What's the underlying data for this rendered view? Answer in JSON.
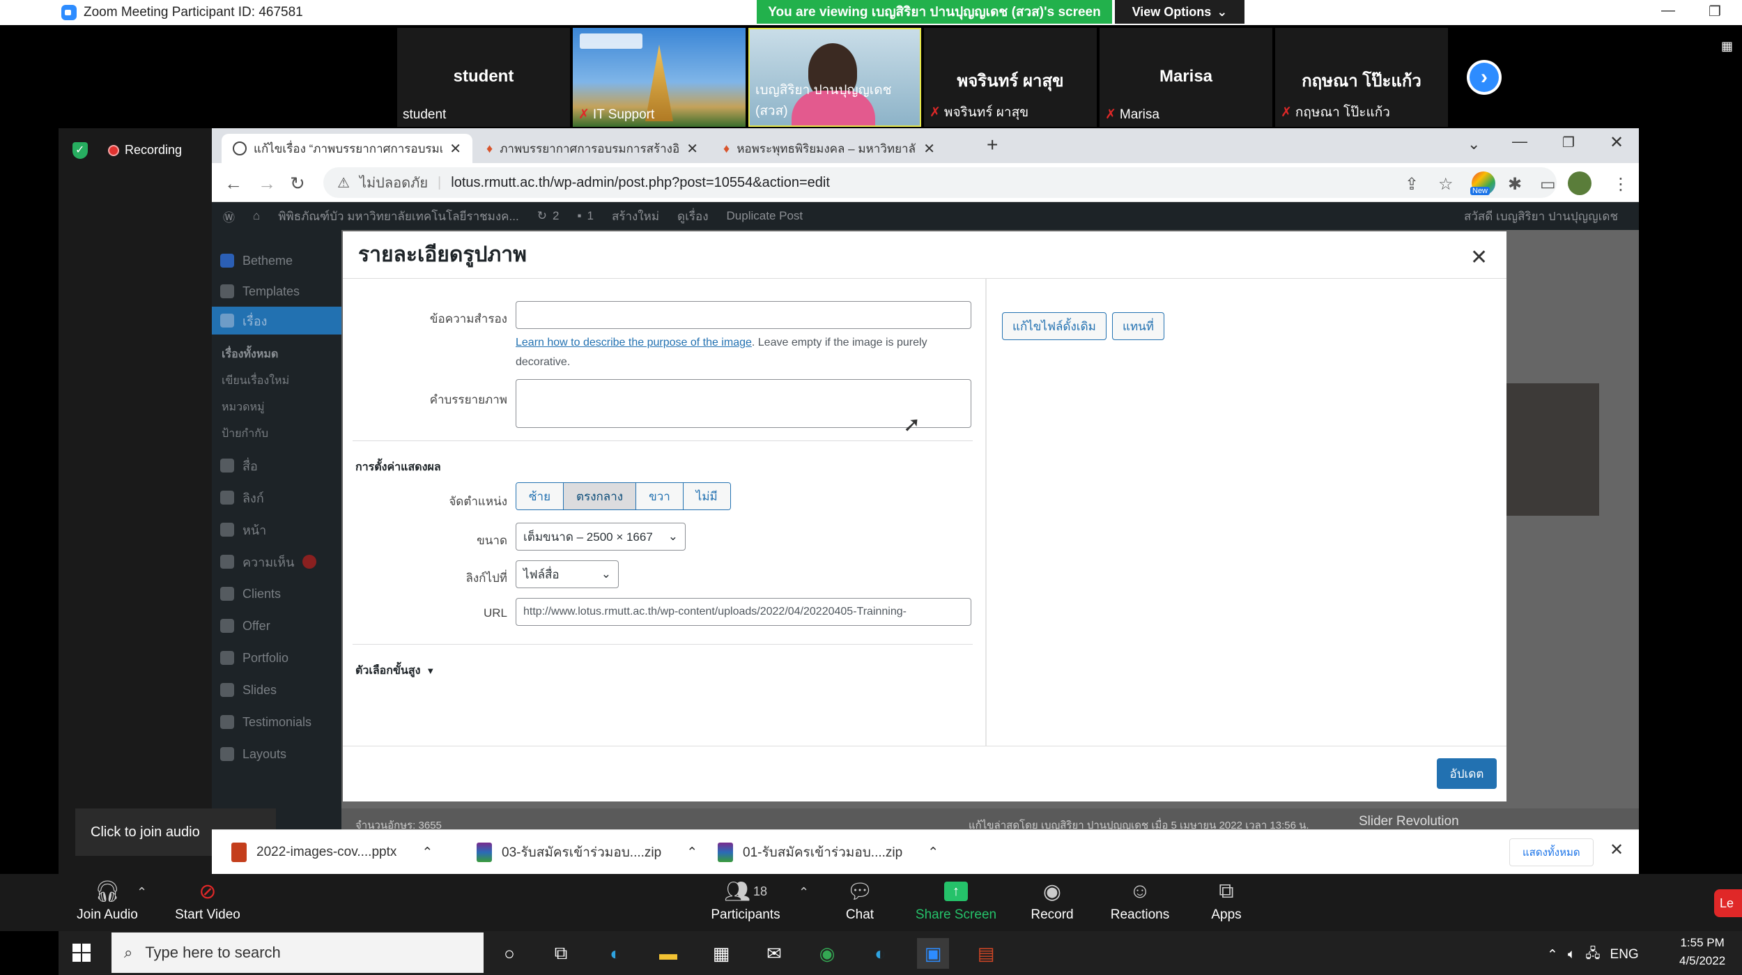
{
  "zoom": {
    "title": "Zoom Meeting Participant ID: 467581",
    "viewing_banner": "You are viewing เบญสิริยา ปานปุญญเดช (สวส)'s screen",
    "view_options": "View Options",
    "recording": "Recording",
    "join_audio_tooltip": "Click to join audio",
    "participants": [
      {
        "name": "student",
        "label": "student",
        "muted": false
      },
      {
        "name": "",
        "label": "IT Support",
        "muted": true
      },
      {
        "name": "",
        "label": "เบญสิริยา ปานปุญญเดช (สวส)",
        "muted": false
      },
      {
        "name": "พจรินทร์ ผาสุข",
        "label": "พจรินทร์ ผาสุข",
        "muted": true
      },
      {
        "name": "Marisa",
        "label": "Marisa",
        "muted": true
      },
      {
        "name": "กฤษณา โป๊ะแก้ว",
        "label": "กฤษณา โป๊ะแก้ว",
        "muted": true
      }
    ],
    "toolbar": {
      "join_audio": "Join Audio",
      "start_video": "Start Video",
      "participants": "Participants",
      "participants_count": "18",
      "chat": "Chat",
      "share_screen": "Share Screen",
      "record": "Record",
      "reactions": "Reactions",
      "apps": "Apps",
      "leave": "Le"
    }
  },
  "browser": {
    "tabs": [
      {
        "label": "แก้ไขเรื่อง “ภาพบรรยากาศการอบรมเ"
      },
      {
        "label": "ภาพบรรยากาศการอบรมการสร้างอินโฟ"
      },
      {
        "label": "หอพระพุทธพิริยมงคล – มหาวิทยาลัยเ"
      }
    ],
    "insecure": "ไม่ปลอดภัย",
    "url": "lotus.rmutt.ac.th/wp-admin/post.php?post=10554&action=edit",
    "profile_badge": "New"
  },
  "wp": {
    "admin_bar": {
      "site": "พิพิธภัณฑ์บัว มหาวิทยาลัยเทคโนโลยีราชมงค...",
      "updates": "2",
      "comments": "1",
      "new": "สร้างใหม่",
      "view": "ดูเรื่อง",
      "duplicate": "Duplicate Post",
      "greeting": "สวัสดี เบญสิริยา ปานปุญญเดช"
    },
    "sidebar": {
      "items": [
        {
          "label": "Betheme"
        },
        {
          "label": "Templates"
        },
        {
          "label": "เรื่อง"
        },
        {
          "label": "สื่อ"
        },
        {
          "label": "ลิงก์"
        },
        {
          "label": "หน้า"
        },
        {
          "label": "ความเห็น"
        },
        {
          "label": "Clients"
        },
        {
          "label": "Offer"
        },
        {
          "label": "Portfolio"
        },
        {
          "label": "Slides"
        },
        {
          "label": "Testimonials"
        },
        {
          "label": "Layouts"
        }
      ],
      "sub": [
        "เรื่องทั้งหมด",
        "เขียนเรื่องใหม่",
        "หมวดหมู่",
        "ป้ายกำกับ"
      ]
    },
    "footer": {
      "word_count": "จำนวนอักษร: 3655",
      "last_edit": "แก้ไขล่าสุดโดย เบญสิริยา ปานปุญญเดช เมื่อ 5 เมษายน 2022 เวลา 13:56 น.",
      "slider": "Slider Revolution"
    }
  },
  "modal": {
    "title": "รายละเอียดรูปภาพ",
    "alt_label": "ข้อความสำรอง",
    "alt_value": "",
    "alt_hint_link": "Learn how to describe the purpose of the image",
    "alt_hint_rest": ". Leave empty if the image is purely decorative.",
    "caption_label": "คำบรรยายภาพ",
    "display_settings": "การตั้งค่าแสดงผล",
    "align_label": "จัดตำแหน่ง",
    "align_options": [
      "ซ้าย",
      "ตรงกลาง",
      "ขวา",
      "ไม่มี"
    ],
    "size_label": "ขนาด",
    "size_value": "เต็มขนาด – 2500 × 1667",
    "link_label": "ลิงก์ไปที่",
    "link_value": "ไฟล์สื่อ",
    "url_label": "URL",
    "url_value": "http://www.lotus.rmutt.ac.th/wp-content/uploads/2022/04/20220405-Trainning-",
    "advanced": "ตัวเลือกขั้นสูง",
    "edit_original": "แก้ไขไฟล์ดั้งเดิม",
    "replace": "แทนที่",
    "update": "อัปเดต"
  },
  "downloads": {
    "items": [
      "2022-images-cov....pptx",
      "03-รับสมัครเข้าร่วมอบ....zip",
      "01-รับสมัครเข้าร่วมอบ....zip"
    ],
    "show_all": "แสดงทั้งหมด"
  },
  "taskbar": {
    "search_placeholder": "Type here to search",
    "lang": "ENG",
    "time": "1:55 PM",
    "date": "4/5/2022"
  }
}
